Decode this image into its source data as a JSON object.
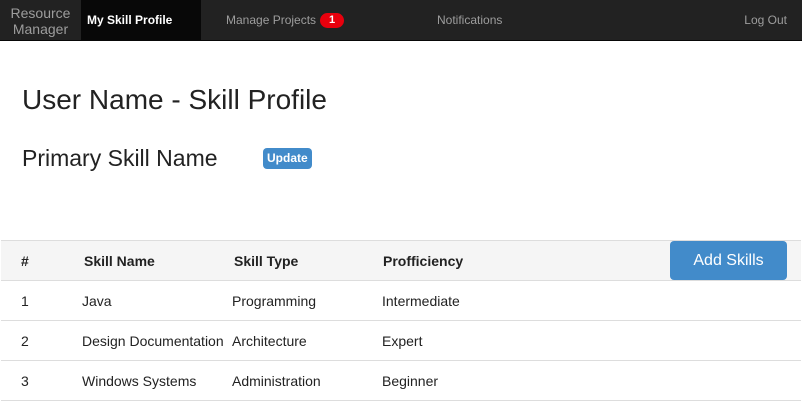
{
  "nav": {
    "brand_line1": "Resource",
    "brand_line2": "Manager",
    "my_skill_profile": "My Skill Profile",
    "manage_projects": "Manage Projects",
    "projects_badge": "1",
    "notifications": "Notifications",
    "logout": "Log Out",
    "badge_color": "#e8000d"
  },
  "page": {
    "title": "User Name - Skill Profile",
    "primary_skill": "Primary Skill Name",
    "update_label": "Update"
  },
  "table": {
    "headers": [
      "#",
      "Skill Name",
      "Skill Type",
      "Profficiency"
    ],
    "add_label": "Add Skills",
    "rows": [
      [
        "1",
        "Java",
        "Programming",
        "Intermediate"
      ],
      [
        "2",
        "Design Documentation",
        "Architecture",
        "Expert"
      ],
      [
        "3",
        "Windows Systems",
        "Administration",
        "Beginner"
      ]
    ]
  },
  "colors": {
    "navbar": "#222222",
    "accent": "#428bca"
  }
}
